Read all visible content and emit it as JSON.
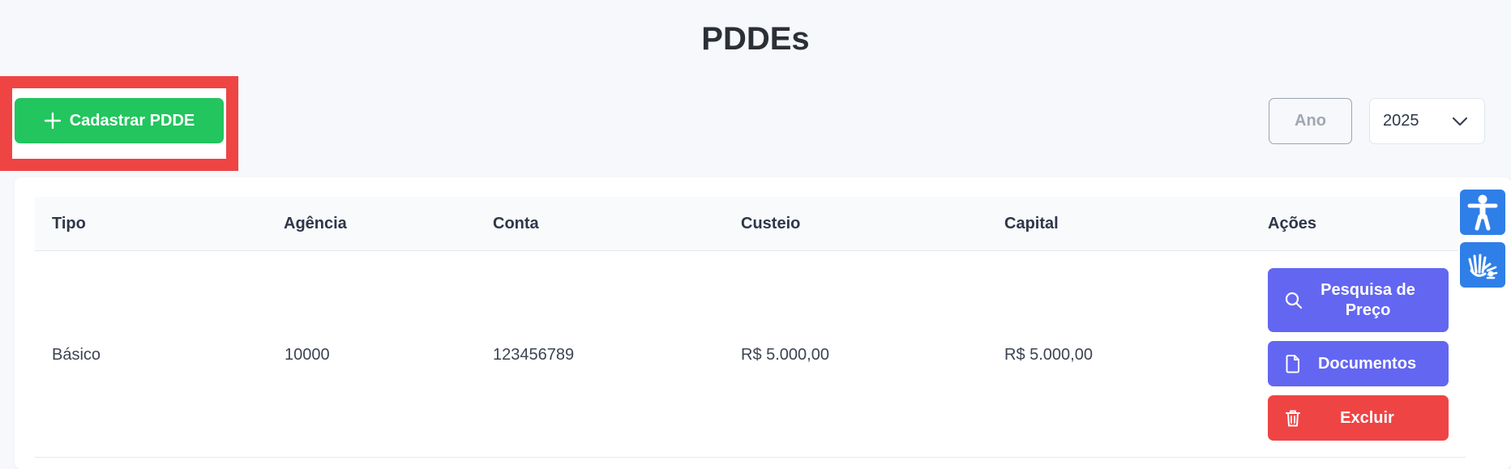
{
  "page": {
    "title": "PDDEs"
  },
  "toolbar": {
    "add_button_label": "Cadastrar PDDE",
    "year_label": "Ano",
    "year_value": "2025"
  },
  "table": {
    "headers": {
      "tipo": "Tipo",
      "agencia": "Agência",
      "conta": "Conta",
      "custeio": "Custeio",
      "capital": "Capital",
      "acoes": "Ações"
    },
    "rows": [
      {
        "tipo": "Básico",
        "agencia": "10000",
        "conta": "123456789",
        "custeio": "R$ 5.000,00",
        "capital": "R$ 5.000,00",
        "actions": {
          "pesquisa": "Pesquisa de Preço",
          "documentos": "Documentos",
          "excluir": "Excluir"
        }
      }
    ]
  },
  "colors": {
    "highlight": "#ef4444",
    "add_button": "#22c55e",
    "primary_action": "#6366f1",
    "danger_action": "#ef4444",
    "accessibility": "#2f7fe8"
  },
  "icons": {
    "add": "plus-icon",
    "year_select": "chevron-down-icon",
    "pesquisa": "search-icon",
    "documentos": "document-icon",
    "excluir": "trash-icon",
    "a11y_1": "accessibility-icon",
    "a11y_2": "sign-language-icon"
  }
}
